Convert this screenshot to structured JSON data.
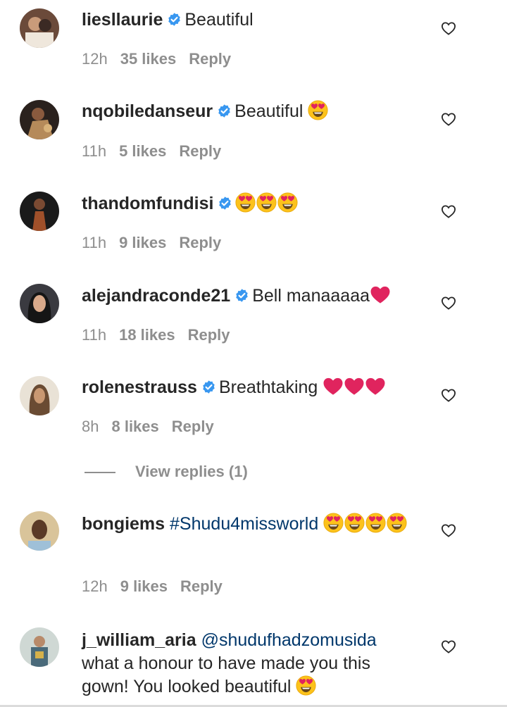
{
  "comments": [
    {
      "username": "liesllaurie",
      "verified": true,
      "text": "Beautiful",
      "time": "12h",
      "likes": "35 likes",
      "reply": "Reply"
    },
    {
      "username": "nqobiledanseur",
      "verified": true,
      "text": "Beautiful",
      "time": "11h",
      "likes": "5 likes",
      "reply": "Reply"
    },
    {
      "username": "thandomfundisi",
      "verified": true,
      "text": "",
      "time": "11h",
      "likes": "9 likes",
      "reply": "Reply"
    },
    {
      "username": "alejandraconde21",
      "verified": true,
      "text": "Bell manaaaaa",
      "time": "11h",
      "likes": "18 likes",
      "reply": "Reply"
    },
    {
      "username": "rolenestrauss",
      "verified": true,
      "text": "Breathtaking",
      "time": "8h",
      "likes": "8 likes",
      "reply": "Reply",
      "view_replies": "View replies (1)"
    },
    {
      "username": "bongiems",
      "verified": false,
      "hashtag": "#Shudu4missworld",
      "time": "12h",
      "likes": "9 likes",
      "reply": "Reply"
    },
    {
      "username": "j_william_aria",
      "verified": false,
      "mention": "@shudufhadzomusida",
      "text": "what a honour to have made you this gown! You looked beautiful"
    }
  ],
  "colors": {
    "verified_badge": "#3897f0",
    "link": "#00376b",
    "meta": "#8e8e8e",
    "heart_emoji": "#e0245e"
  },
  "icons": {
    "like": "heart-outline-icon",
    "verified": "verified-badge-icon",
    "emoji": "heart-eyes-emoji",
    "red_heart": "red-heart-emoji"
  }
}
